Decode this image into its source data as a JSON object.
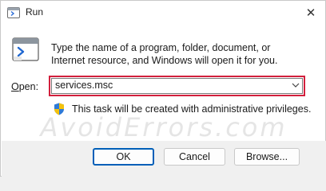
{
  "window": {
    "title": "Run",
    "close_glyph": "✕",
    "icon": "run-app-icon"
  },
  "main": {
    "description": "Type the name of a program, folder, document, or Internet resource, and Windows will open it for you.",
    "open_label_underlined": "O",
    "open_label_rest": "pen:",
    "open_value": "services.msc",
    "admin_note": "This task will be created with administrative privileges.",
    "shield_icon": "uac-shield-icon",
    "highlight_color": "#d21f3c"
  },
  "watermark": "AvoidErrors.com",
  "buttons": {
    "ok": "OK",
    "cancel": "Cancel",
    "browse": "Browse..."
  }
}
